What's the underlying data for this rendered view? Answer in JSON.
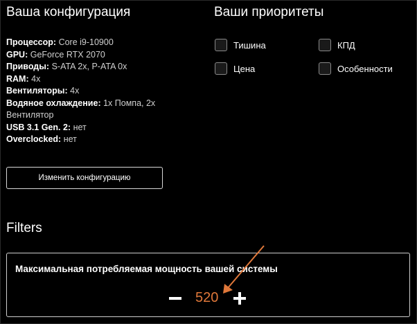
{
  "config": {
    "title": "Ваша конфигурация",
    "items": [
      {
        "key": "Процессор:",
        "value": "Core i9-10900"
      },
      {
        "key": "GPU:",
        "value": "GeForce RTX 2070"
      },
      {
        "key": "Приводы:",
        "value": "S-ATA 2x, P-ATA 0x"
      },
      {
        "key": "RAM:",
        "value": "4x"
      },
      {
        "key": "Вентиляторы:",
        "value": "4x"
      },
      {
        "key": "Водяное охлаждение:",
        "value": "1x Помпа, 2x Вентилятор"
      },
      {
        "key": "USB 3.1 Gen. 2:",
        "value": "нет"
      },
      {
        "key": "Overclocked:",
        "value": "нет"
      }
    ],
    "change_button": "Изменить конфигурацию"
  },
  "priorities": {
    "title": "Ваши приоритеты",
    "items": [
      {
        "label": "Тишина",
        "checked": false
      },
      {
        "label": "КПД",
        "checked": false
      },
      {
        "label": "Цена",
        "checked": false
      },
      {
        "label": "Особенности",
        "checked": false
      }
    ]
  },
  "filters": {
    "title": "Filters",
    "power": {
      "label": "Максимальная потребляемая мощность вашей системы",
      "value": "520",
      "value_color": "#e0783a"
    }
  },
  "colors": {
    "background": "#000000",
    "accent": "#e0783a",
    "annotation_arrow": "#e0783a"
  }
}
